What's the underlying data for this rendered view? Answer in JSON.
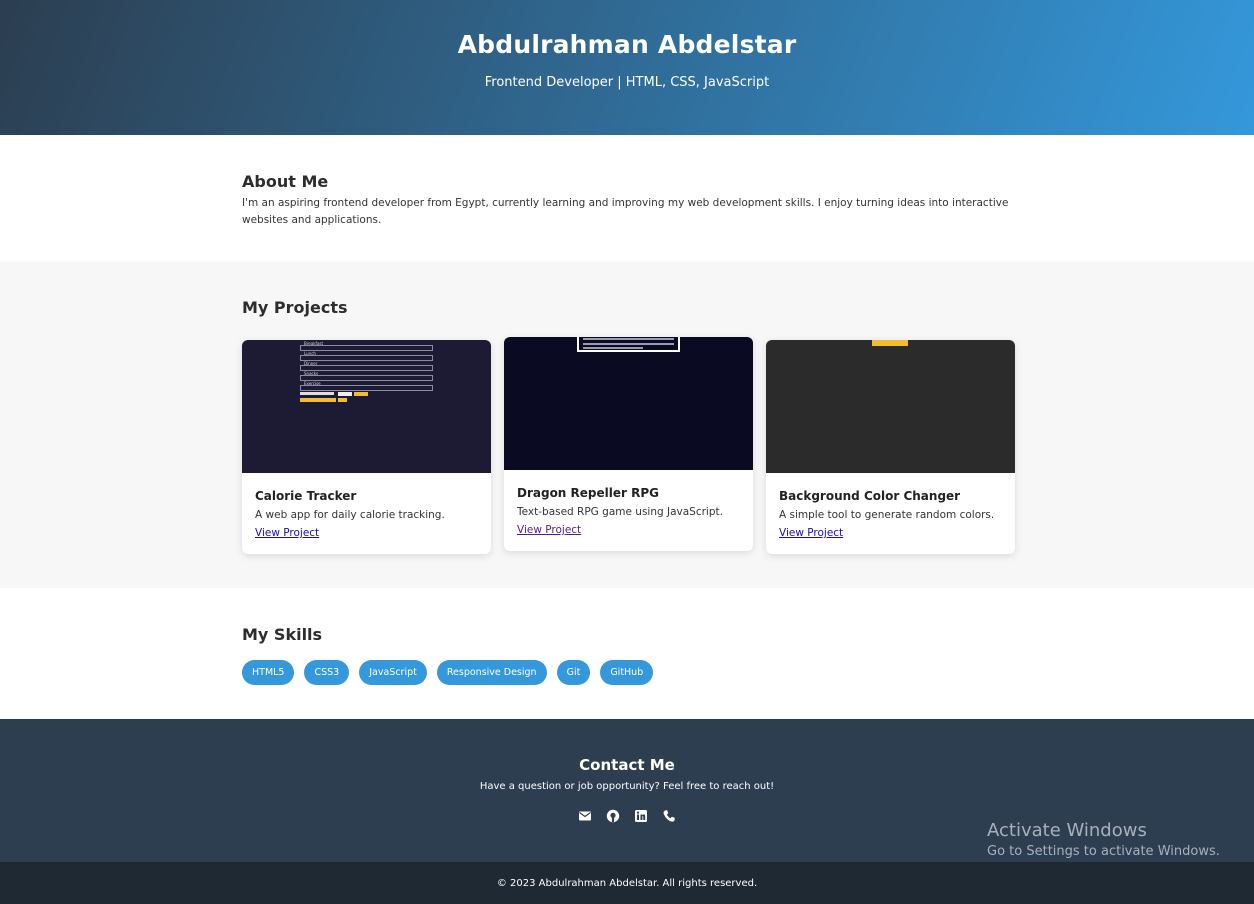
{
  "hero": {
    "name": "Abdulrahman Abdelstar",
    "tagline": "Frontend Developer | HTML, CSS, JavaScript"
  },
  "about": {
    "heading": "About Me",
    "text": "I'm an aspiring frontend developer from Egypt, currently learning and improving my web development skills. I enjoy turning ideas into interactive websites and applications."
  },
  "projects": {
    "heading": "My Projects",
    "items": [
      {
        "title": "Calorie Tracker",
        "description": "A web app for daily calorie tracking.",
        "link": "View Project",
        "thumb_bg": "#1c1b33"
      },
      {
        "title": "Dragon Repeller RPG",
        "description": "Text-based RPG game using JavaScript.",
        "link": "View Project",
        "thumb_bg": "#0a0a23"
      },
      {
        "title": "Background Color Changer",
        "description": "A simple tool to generate random colors.",
        "link": "View Project",
        "thumb_bg": "#2b2b2b"
      }
    ],
    "calorie_thumb_labels": [
      "Breakfast",
      "Lunch",
      "Dinner",
      "Snacks",
      "Exercise"
    ]
  },
  "skills": {
    "heading": "My Skills",
    "tags": [
      "HTML5",
      "CSS3",
      "JavaScript",
      "Responsive Design",
      "Git",
      "GitHub"
    ]
  },
  "contact": {
    "heading": "Contact Me",
    "text": "Have a question or job opportunity? Feel free to reach out!",
    "icons": [
      "envelope-icon",
      "github-icon",
      "linkedin-icon",
      "phone-icon"
    ]
  },
  "footer": {
    "text": "© 2023 Abdulrahman Abdelstar. All rights reserved."
  },
  "watermark": {
    "line1": "Activate Windows",
    "line2": "Go to Settings to activate Windows."
  },
  "colors": {
    "accent": "#3498db",
    "dark": "#2c3e50",
    "footer": "#1e2933"
  }
}
